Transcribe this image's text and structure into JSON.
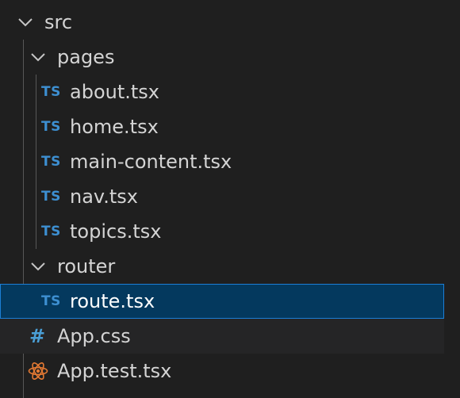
{
  "explorer": {
    "src_folder": "src",
    "pages_folder": "pages",
    "router_folder": "router",
    "pages_files": [
      {
        "label": "about.tsx",
        "icon_text": "TS"
      },
      {
        "label": "home.tsx",
        "icon_text": "TS"
      },
      {
        "label": "main-content.tsx",
        "icon_text": "TS"
      },
      {
        "label": "nav.tsx",
        "icon_text": "TS"
      },
      {
        "label": "topics.tsx",
        "icon_text": "TS"
      }
    ],
    "router_files": [
      {
        "label": "route.tsx",
        "icon_text": "TS",
        "selected": true
      }
    ],
    "src_files": [
      {
        "label": "App.css",
        "icon": "css-hash-icon",
        "icon_text": "#"
      },
      {
        "label": "App.test.tsx",
        "icon": "react-icon"
      }
    ]
  },
  "colors": {
    "background": "#1f1f1f",
    "selection": "#04395e",
    "selection_border": "#1c7fd6",
    "ts_icon": "#3d8fd1",
    "react_icon": "#e37933"
  }
}
